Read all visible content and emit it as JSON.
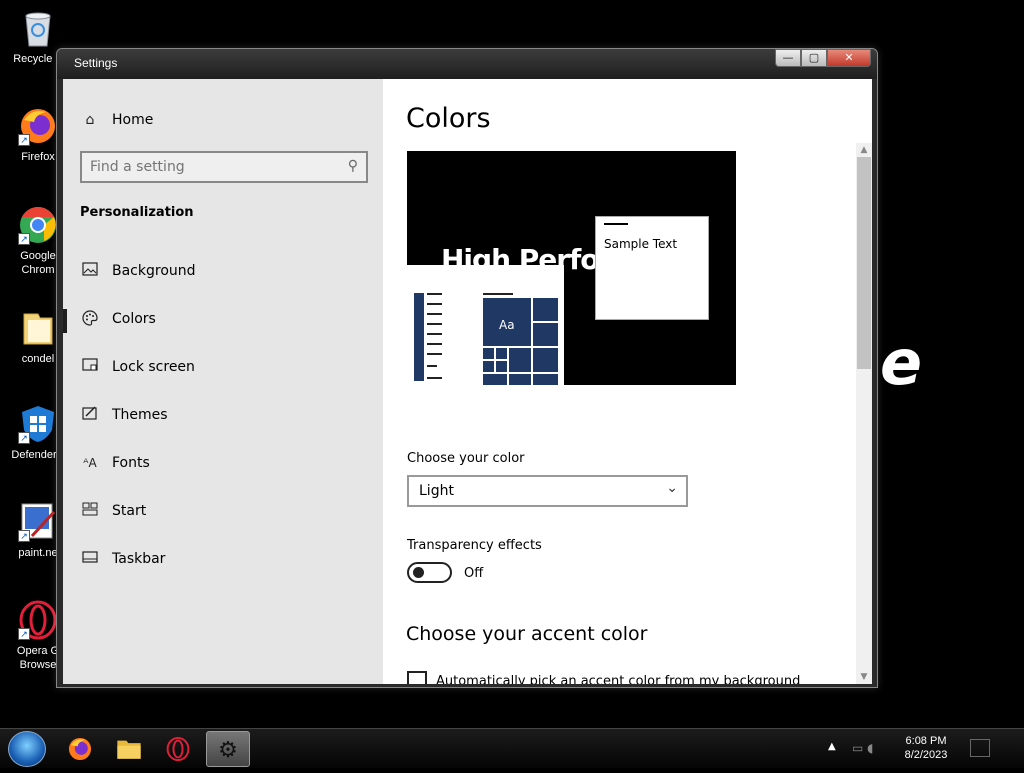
{
  "desktop": {
    "icons": [
      {
        "label": "Recycle B",
        "name": "recycle-bin"
      },
      {
        "label": "Firefox",
        "name": "firefox"
      },
      {
        "label": "Google\nChrom",
        "name": "chrome"
      },
      {
        "label": "condel",
        "name": "folder"
      },
      {
        "label": "DefenderC",
        "name": "defender"
      },
      {
        "label": "paint.ne",
        "name": "paint-net"
      },
      {
        "label": "Opera G\nBrowse",
        "name": "opera-gx"
      }
    ]
  },
  "window": {
    "title": "Settings",
    "controls": {
      "minimize": "—",
      "maximize": "▢",
      "close": "✕"
    }
  },
  "sidebar": {
    "home": "Home",
    "search_placeholder": "Find a setting",
    "section": "Personalization",
    "items": [
      {
        "label": "Background",
        "icon": "image-icon"
      },
      {
        "label": "Colors",
        "icon": "palette-icon"
      },
      {
        "label": "Lock screen",
        "icon": "lock-screen-icon"
      },
      {
        "label": "Themes",
        "icon": "themes-icon"
      },
      {
        "label": "Fonts",
        "icon": "fonts-icon"
      },
      {
        "label": "Start",
        "icon": "start-icon"
      },
      {
        "label": "Taskbar",
        "icon": "taskbar-icon"
      }
    ],
    "active_item": "Colors"
  },
  "content": {
    "title": "Colors",
    "preview": {
      "banner_text": "High Perfo",
      "tile_text": "Aa",
      "sample_text": "Sample Text"
    },
    "choose_color_label": "Choose your color",
    "choose_color_value": "Light",
    "transparency_label": "Transparency effects",
    "transparency_state": "Off",
    "accent_title": "Choose your accent color",
    "auto_accent_label": "Automatically pick an accent color from my background"
  },
  "colors": {
    "accent": "#1f3864",
    "sidebar_bg": "#e6e6e6",
    "content_bg": "#ffffff"
  },
  "taskbar": {
    "time": "6:08 PM",
    "date": "8/2/2023"
  }
}
